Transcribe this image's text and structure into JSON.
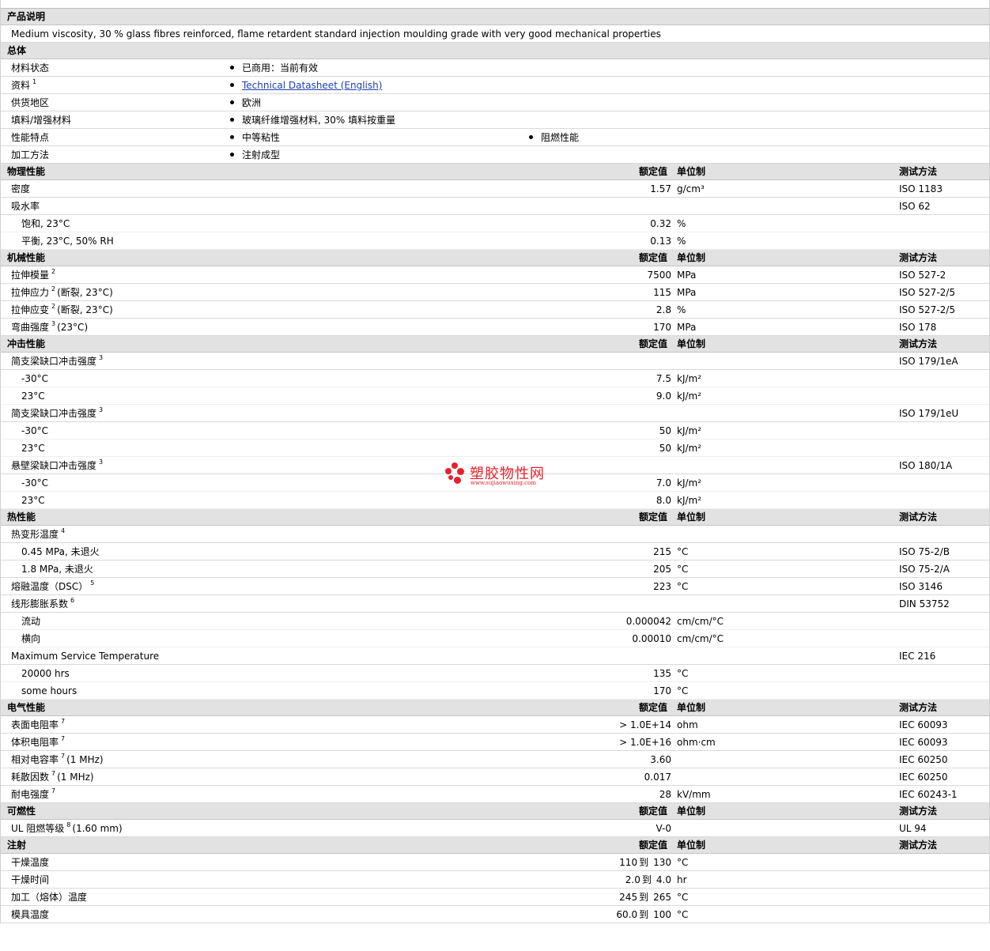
{
  "description": {
    "title": "产品说明",
    "text": "Medium viscosity, 30 % glass fibres reinforced, flame retardent standard injection moulding grade with very good mechanical properties"
  },
  "general": {
    "title": "总体",
    "rows": [
      {
        "label": "材料状态",
        "values": [
          "已商用：当前有效"
        ]
      },
      {
        "label": "资料",
        "sup": "1",
        "link": "Technical Datasheet (English)"
      },
      {
        "label": "供货地区",
        "values": [
          "欧洲"
        ]
      },
      {
        "label": "填料/增强材料",
        "values": [
          "玻璃纤维增强材料, 30% 填料按重量"
        ]
      },
      {
        "label": "性能特点",
        "values": [
          "中等粘性",
          "阻燃性能"
        ]
      },
      {
        "label": "加工方法",
        "values": [
          "注射成型"
        ]
      }
    ]
  },
  "col_headers": {
    "value": "额定值",
    "unit": "单位制",
    "test": "测试方法"
  },
  "sections": {
    "physical": {
      "title": "物理性能",
      "rows": [
        {
          "label": "密度",
          "value": "1.57",
          "unit": "g/cm³",
          "test": "ISO 1183"
        },
        {
          "label": "吸水率",
          "test": "ISO 62"
        },
        {
          "label": "饱和, 23°C",
          "value": "0.32",
          "unit": "%"
        },
        {
          "label": "平衡, 23°C, 50% RH",
          "value": "0.13",
          "unit": "%"
        }
      ]
    },
    "mechanical": {
      "title": "机械性能",
      "rows": [
        {
          "label": "拉伸模量",
          "sup": "2",
          "value": "7500",
          "unit": "MPa",
          "test": "ISO 527-2"
        },
        {
          "label": "拉伸应力",
          "sup": "2",
          "suffix": "(断裂, 23°C)",
          "value": "115",
          "unit": "MPa",
          "test": "ISO 527-2/5"
        },
        {
          "label": "拉伸应变",
          "sup": "2",
          "suffix": "(断裂, 23°C)",
          "value": "2.8",
          "unit": "%",
          "test": "ISO 527-2/5"
        },
        {
          "label": "弯曲强度",
          "sup": "3",
          "suffix": "(23°C)",
          "value": "170",
          "unit": "MPa",
          "test": "ISO 178"
        }
      ]
    },
    "impact": {
      "title": "冲击性能",
      "rows": [
        {
          "label": "简支梁缺口冲击强度",
          "sup": "3",
          "test": "ISO 179/1eA"
        },
        {
          "label": "-30°C",
          "value": "7.5",
          "unit": "kJ/m²"
        },
        {
          "label": "23°C",
          "value": "9.0",
          "unit": "kJ/m²"
        },
        {
          "label": "简支梁缺口冲击强度",
          "sup": "3",
          "test": "ISO 179/1eU"
        },
        {
          "label": "-30°C",
          "value": "50",
          "unit": "kJ/m²"
        },
        {
          "label": "23°C",
          "value": "50",
          "unit": "kJ/m²"
        },
        {
          "label": "悬壁梁缺口冲击强度",
          "sup": "3",
          "test": "ISO 180/1A"
        },
        {
          "label": "-30°C",
          "value": "7.0",
          "unit": "kJ/m²"
        },
        {
          "label": "23°C",
          "value": "8.0",
          "unit": "kJ/m²"
        }
      ]
    },
    "thermal": {
      "title": "热性能",
      "rows": [
        {
          "label": "热变形温度",
          "sup": "4"
        },
        {
          "label": "0.45 MPa, 未退火",
          "value": "215",
          "unit": "°C",
          "test": "ISO 75-2/B"
        },
        {
          "label": "1.8 MPa, 未退火",
          "value": "205",
          "unit": "°C",
          "test": "ISO 75-2/A"
        },
        {
          "label": "熔融温度（DSC）",
          "sup": "5",
          "value": "223",
          "unit": "°C",
          "test": "ISO 3146"
        },
        {
          "label": "线形膨胀系数",
          "sup": "6",
          "test": "DIN 53752"
        },
        {
          "label": "流动",
          "value": "0.000042",
          "unit": "cm/cm/°C"
        },
        {
          "label": "横向",
          "value": "0.00010",
          "unit": "cm/cm/°C"
        },
        {
          "label": "Maximum Service Temperature",
          "test": "IEC 216"
        },
        {
          "label": "20000 hrs",
          "value": "135",
          "unit": "°C"
        },
        {
          "label": "some hours",
          "value": "170",
          "unit": "°C"
        }
      ]
    },
    "electrical": {
      "title": "电气性能",
      "rows": [
        {
          "label": "表面电阻率",
          "sup": "7",
          "value": "> 1.0E+14",
          "unit": "ohm",
          "test": "IEC 60093"
        },
        {
          "label": "体积电阻率",
          "sup": "7",
          "value": "> 1.0E+16",
          "unit": "ohm·cm",
          "test": "IEC 60093"
        },
        {
          "label": "相对电容率",
          "sup": "7",
          "suffix": "(1 MHz)",
          "value": "3.60",
          "test": "IEC 60250"
        },
        {
          "label": "耗散因数",
          "sup": "7",
          "suffix": "(1 MHz)",
          "value": "0.017",
          "test": "IEC 60250"
        },
        {
          "label": "耐电强度",
          "sup": "7",
          "value": "28",
          "unit": "kV/mm",
          "test": "IEC 60243-1"
        }
      ]
    },
    "flammability": {
      "title": "可燃性",
      "rows": [
        {
          "label": "UL 阻燃等级",
          "sup": "8",
          "suffix": "(1.60 mm)",
          "value": "V-0",
          "test": "UL 94"
        }
      ]
    },
    "injection": {
      "title": "注射",
      "rows": [
        {
          "label": "干燥温度",
          "range": [
            "110",
            "130"
          ],
          "unit": "°C"
        },
        {
          "label": "干燥时间",
          "range": [
            "2.0",
            "4.0"
          ],
          "unit": "hr"
        },
        {
          "label": "加工（熔体）温度",
          "range": [
            "245",
            "265"
          ],
          "unit": "°C"
        },
        {
          "label": "模具温度",
          "range": [
            "60.0",
            "100"
          ],
          "unit": "°C"
        }
      ]
    }
  },
  "range_word": "到",
  "watermark": {
    "text": "塑胶物性网",
    "url": "www.sujiaowuxing.com"
  },
  "colors": {
    "header_bg": "#e2e2e2",
    "link": "#1a3fb5",
    "watermark": "#e8202a"
  }
}
